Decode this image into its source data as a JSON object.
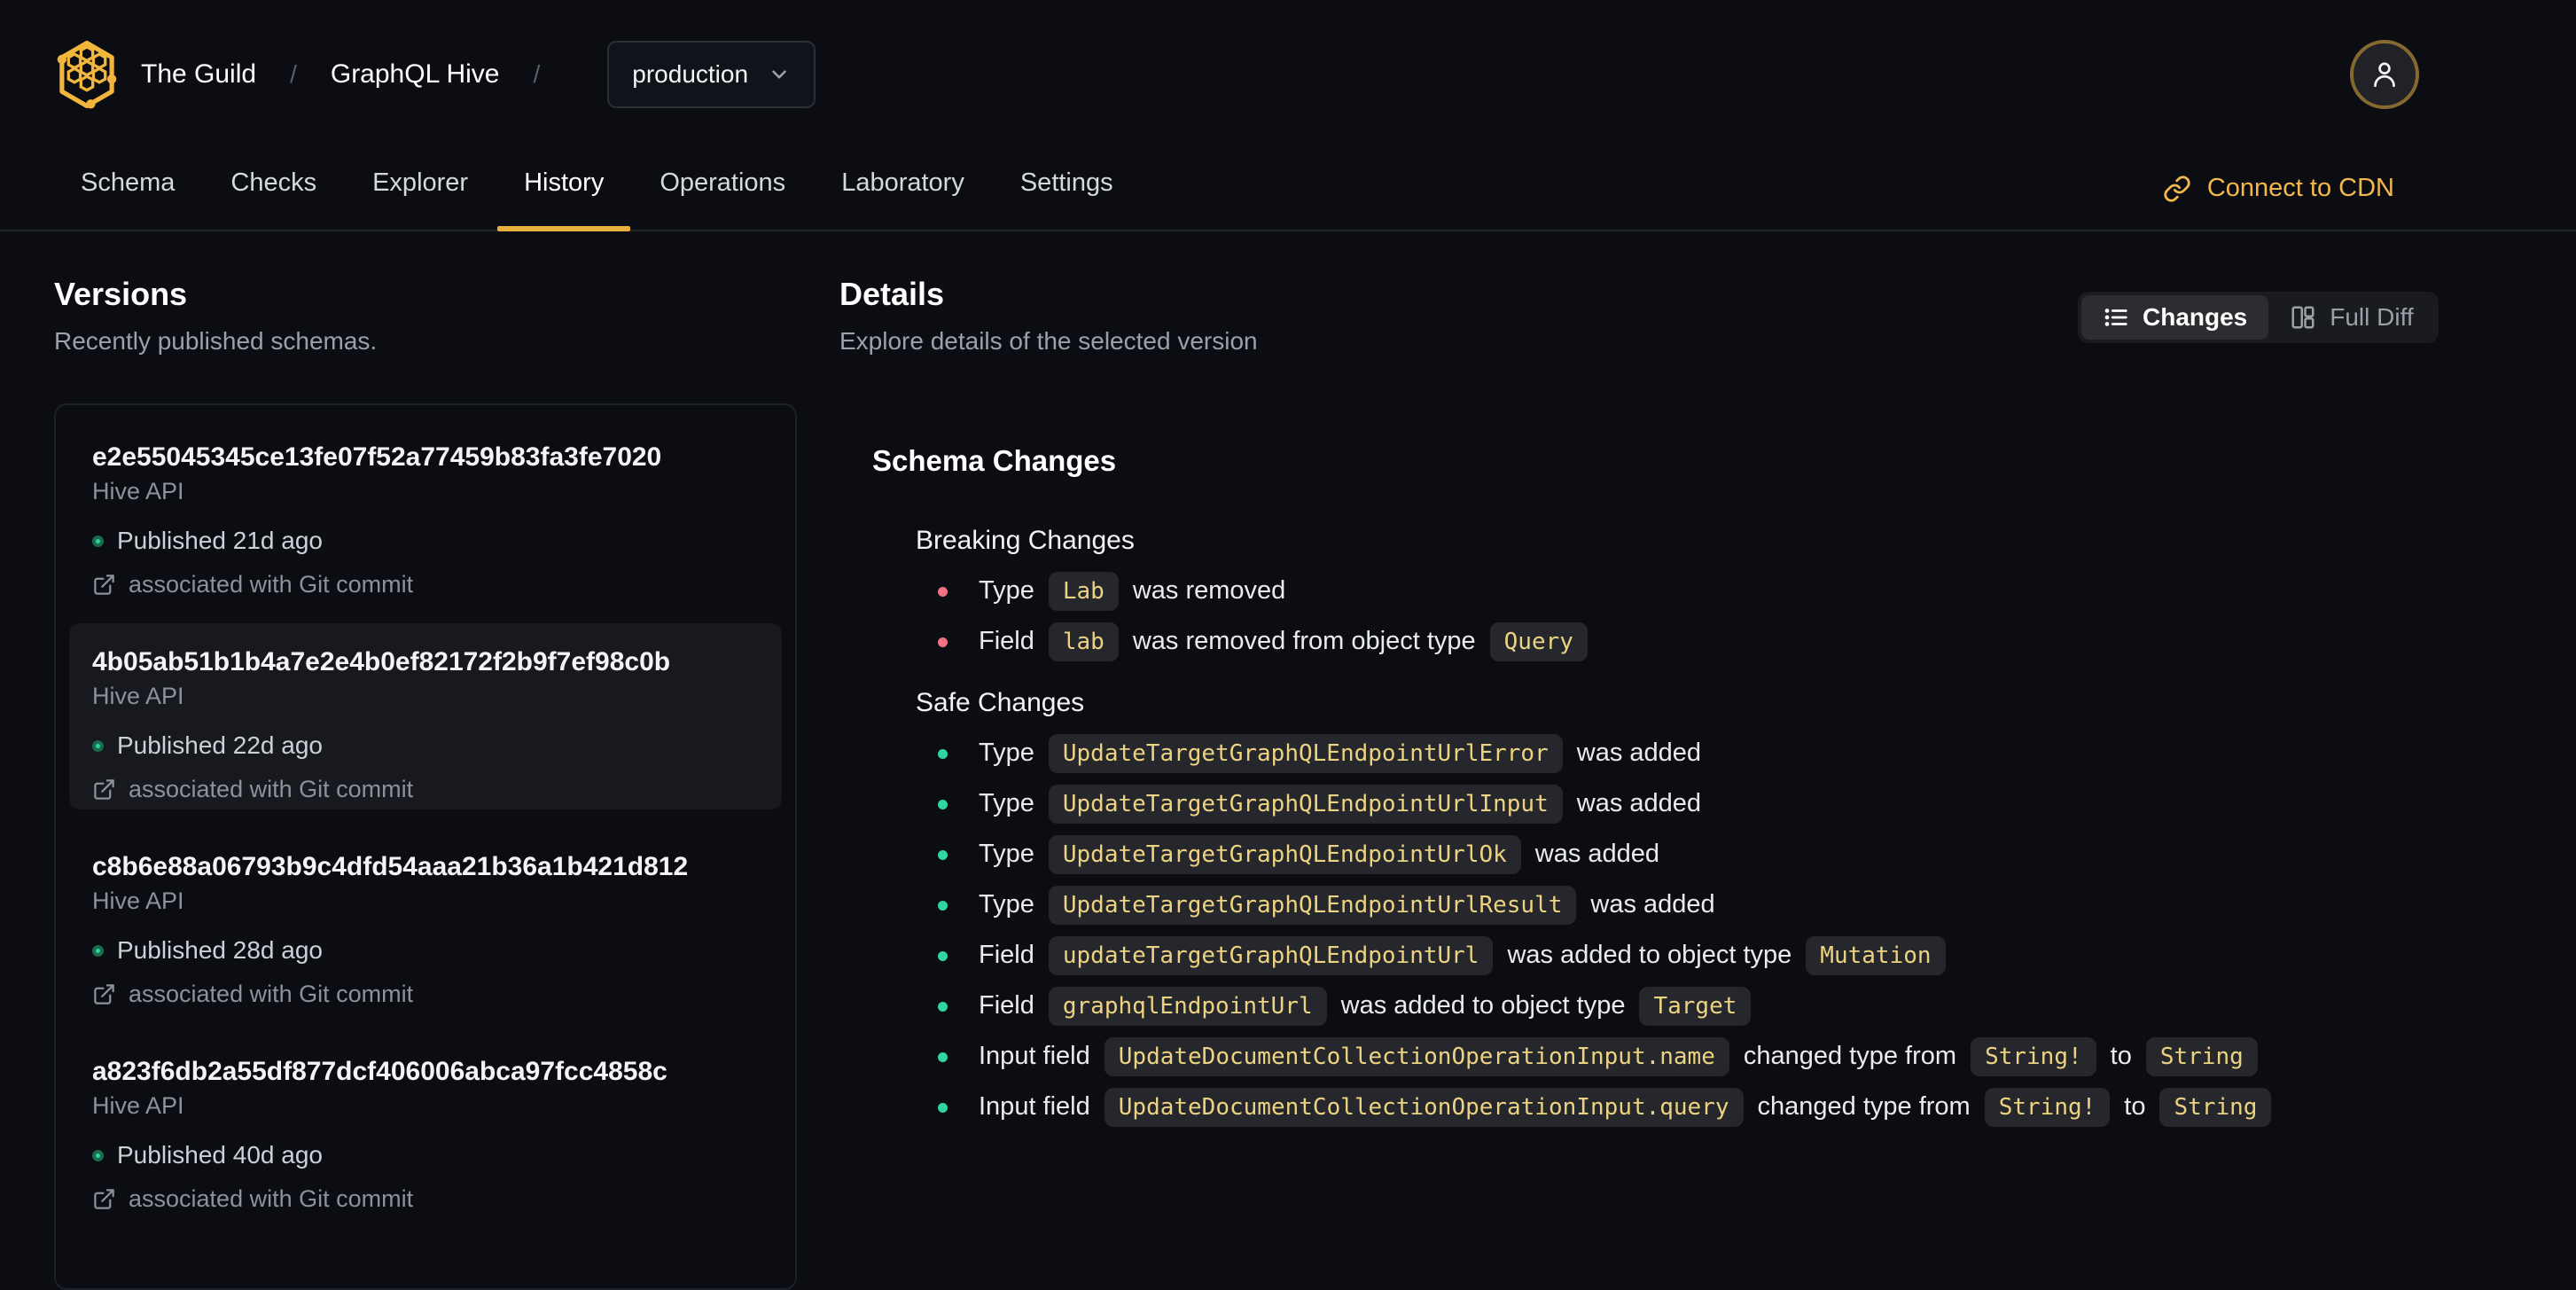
{
  "header": {
    "org": "The Guild",
    "separator": "/",
    "project": "GraphQL Hive",
    "target_selector": {
      "value": "production"
    },
    "tabs": [
      {
        "label": "Schema",
        "active": false
      },
      {
        "label": "Checks",
        "active": false
      },
      {
        "label": "Explorer",
        "active": false
      },
      {
        "label": "History",
        "active": true
      },
      {
        "label": "Operations",
        "active": false
      },
      {
        "label": "Laboratory",
        "active": false
      },
      {
        "label": "Settings",
        "active": false
      }
    ],
    "connect_cdn_label": "Connect to CDN"
  },
  "versions": {
    "title": "Versions",
    "subtitle": "Recently published schemas.",
    "items": [
      {
        "hash": "e2e55045345ce13fe07f52a77459b83fa3fe7020",
        "service": "Hive API",
        "status": "Published 21d ago",
        "git": "associated with Git commit",
        "selected": false
      },
      {
        "hash": "4b05ab51b1b4a7e2e4b0ef82172f2b9f7ef98c0b",
        "service": "Hive API",
        "status": "Published 22d ago",
        "git": "associated with Git commit",
        "selected": true
      },
      {
        "hash": "c8b6e88a06793b9c4dfd54aaa21b36a1b421d812",
        "service": "Hive API",
        "status": "Published 28d ago",
        "git": "associated with Git commit",
        "selected": false
      },
      {
        "hash": "a823f6db2a55df877dcf406006abca97fcc4858c",
        "service": "Hive API",
        "status": "Published 40d ago",
        "git": "associated with Git commit",
        "selected": false
      }
    ]
  },
  "details": {
    "title": "Details",
    "subtitle": "Explore details of the selected version",
    "view_toggle": {
      "changes_label": "Changes",
      "full_diff_label": "Full Diff",
      "active": "changes"
    },
    "schema_changes": {
      "title": "Schema Changes",
      "groups": [
        {
          "title": "Breaking Changes",
          "severity": "breaking",
          "items": [
            [
              {
                "text": "Type"
              },
              {
                "code": "Lab"
              },
              {
                "text": "was removed"
              }
            ],
            [
              {
                "text": "Field"
              },
              {
                "code": "lab"
              },
              {
                "text": "was removed from object type"
              },
              {
                "code": "Query"
              }
            ]
          ]
        },
        {
          "title": "Safe Changes",
          "severity": "safe",
          "items": [
            [
              {
                "text": "Type"
              },
              {
                "code": "UpdateTargetGraphQLEndpointUrlError"
              },
              {
                "text": "was added"
              }
            ],
            [
              {
                "text": "Type"
              },
              {
                "code": "UpdateTargetGraphQLEndpointUrlInput"
              },
              {
                "text": "was added"
              }
            ],
            [
              {
                "text": "Type"
              },
              {
                "code": "UpdateTargetGraphQLEndpointUrlOk"
              },
              {
                "text": "was added"
              }
            ],
            [
              {
                "text": "Type"
              },
              {
                "code": "UpdateTargetGraphQLEndpointUrlResult"
              },
              {
                "text": "was added"
              }
            ],
            [
              {
                "text": "Field"
              },
              {
                "code": "updateTargetGraphQLEndpointUrl"
              },
              {
                "text": "was added to object type"
              },
              {
                "code": "Mutation"
              }
            ],
            [
              {
                "text": "Field"
              },
              {
                "code": "graphqlEndpointUrl"
              },
              {
                "text": "was added to object type"
              },
              {
                "code": "Target"
              }
            ],
            [
              {
                "text": "Input field"
              },
              {
                "code": "UpdateDocumentCollectionOperationInput.name"
              },
              {
                "text": "changed type from"
              },
              {
                "code": "String!"
              },
              {
                "text": "to"
              },
              {
                "code": "String"
              }
            ],
            [
              {
                "text": "Input field"
              },
              {
                "code": "UpdateDocumentCollectionOperationInput.query"
              },
              {
                "text": "changed type from"
              },
              {
                "code": "String!"
              },
              {
                "text": "to"
              },
              {
                "code": "String"
              }
            ]
          ]
        }
      ]
    }
  },
  "colors": {
    "background": "#0b0d13",
    "accent_gold": "#f0b63e",
    "code_text": "#ecd381",
    "breaking_bullet": "#ee7384",
    "safe_bullet": "#30d5a0",
    "published_dot": "#2fd49e"
  }
}
